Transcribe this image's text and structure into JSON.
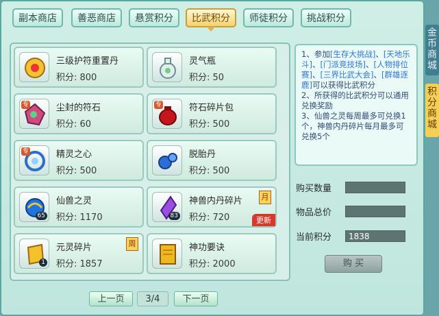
{
  "tabs": [
    {
      "label": "副本商店",
      "active": false
    },
    {
      "label": "善恶商店",
      "active": false
    },
    {
      "label": "悬赏积分",
      "active": false
    },
    {
      "label": "比武积分",
      "active": true
    },
    {
      "label": "师徒积分",
      "active": false
    },
    {
      "label": "挑战积分",
      "active": false
    }
  ],
  "items": [
    {
      "name": "三级护符重置丹",
      "points": "积分: 800",
      "icon": "gold-charm-icon"
    },
    {
      "name": "灵气瓶",
      "points": "积分: 50",
      "icon": "spirit-vase-icon"
    },
    {
      "name": "尘封的符石",
      "points": "积分: 60",
      "icon": "rune-stone-icon",
      "tag": "专"
    },
    {
      "name": "符石碎片包",
      "points": "积分: 500",
      "icon": "red-pouch-icon",
      "tag": "专"
    },
    {
      "name": "精灵之心",
      "points": "积分: 500",
      "icon": "spirit-heart-icon",
      "tag": "专"
    },
    {
      "name": "脱胎丹",
      "points": "积分: 500",
      "icon": "blue-pill-icon"
    },
    {
      "name": "仙兽之灵",
      "points": "积分: 1170",
      "icon": "beast-orb-icon",
      "qty": "65"
    },
    {
      "name": "神兽内丹碎片",
      "points": "积分: 720",
      "icon": "purple-crystal-icon",
      "qty": "83",
      "badge": "月",
      "ribbon": "更新"
    },
    {
      "name": "元灵碎片",
      "points": "积分: 1857",
      "icon": "yuanling-shard-icon",
      "qty": "1",
      "badge": "周"
    },
    {
      "name": "神功要诀",
      "points": "积分: 2000",
      "icon": "golden-book-icon"
    }
  ],
  "info": {
    "line1a": "1、参加",
    "line1b": "[生存大挑战]",
    "line1c": "、",
    "line1d": "[天地乐斗]",
    "line1e": "、",
    "line1f": "[门派竞技场]",
    "line1g": "、",
    "line1h": "[人物排位赛]",
    "line1i": "、",
    "line1j": "[三界比武大会]",
    "line1k": "、",
    "line1l": "[群雄逐鹿]",
    "line1m": "可以获得比武积分",
    "line2": "2、所获得的比武积分可以通用兑换奖励",
    "line3": "3、仙兽之灵每周最多可兑换1个，神兽内丹碎片每月最多可兑换5个"
  },
  "form": {
    "buy_qty_label": "购买数量",
    "total_label": "物品总价",
    "current_label": "当前积分",
    "buy_qty": "",
    "total": "",
    "current": "1838"
  },
  "buy_button": "购 买",
  "pager": {
    "prev": "上一页",
    "page": "3/4",
    "next": "下一页"
  },
  "side_tabs": [
    {
      "label": "金币商城",
      "active": false
    },
    {
      "label": "积分商城",
      "active": true
    }
  ]
}
